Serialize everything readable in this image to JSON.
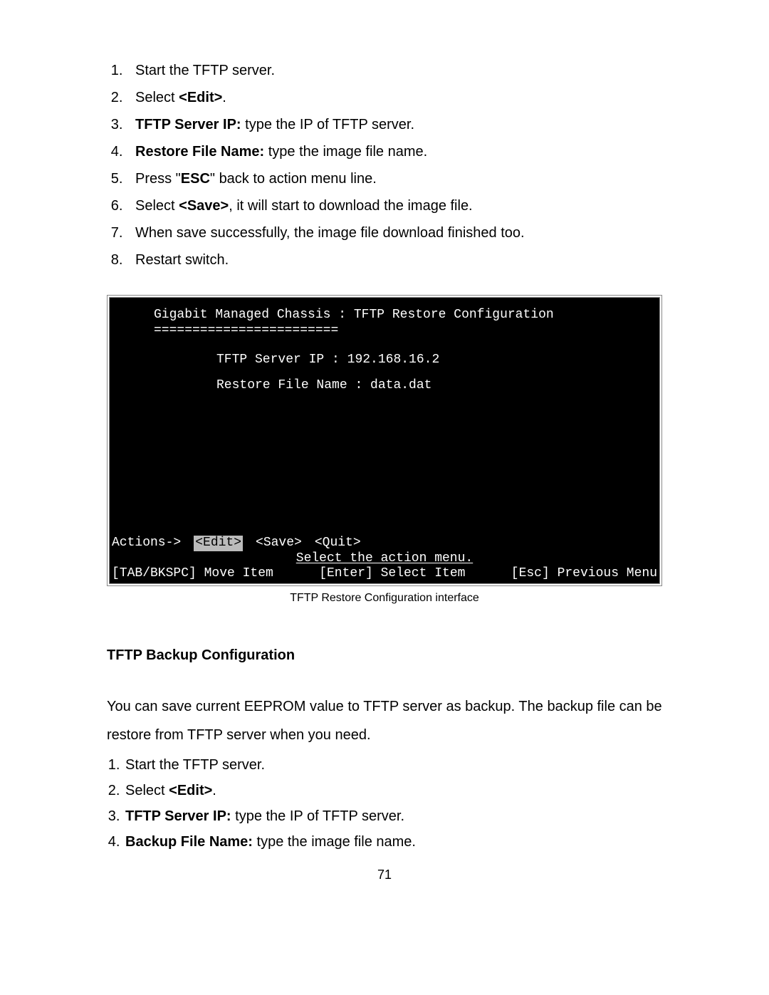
{
  "steps_top": [
    {
      "pre": "Start the TFTP server.",
      "bold": "",
      "post": ""
    },
    {
      "pre": "Select ",
      "bold": "<Edit>",
      "post": "."
    },
    {
      "pre": "",
      "bold": "TFTP Server IP:",
      "post": " type the IP of TFTP server."
    },
    {
      "pre": "",
      "bold": "Restore File Name:",
      "post": " type the image file name."
    },
    {
      "pre": "Press \"",
      "bold": "ESC",
      "post": "\" back to action menu line."
    },
    {
      "pre": "Select ",
      "bold": "<Save>",
      "post": ", it will start to download the image file."
    },
    {
      "pre": "When save successfully, the image file download finished too.",
      "bold": "",
      "post": ""
    },
    {
      "pre": "Restart switch.",
      "bold": "",
      "post": ""
    }
  ],
  "terminal": {
    "title": "Gigabit Managed Chassis : TFTP Restore Configuration",
    "rule": "========================",
    "ip_label": "TFTP Server IP",
    "ip_sep": "   : ",
    "ip_value": "192.168.16.2",
    "file_label": "Restore File Name",
    "file_sep": " : ",
    "file_value": "data.dat",
    "actions_label": "Actions->",
    "edit": "<Edit>",
    "save": "<Save>",
    "quit": "<Quit>",
    "hint": "Select the action menu.",
    "foot_left": "[TAB/BKSPC] Move Item",
    "foot_mid": "[Enter] Select Item",
    "foot_right": "[Esc] Previous Menu"
  },
  "caption": "TFTP Restore Configuration interface",
  "section_title": "TFTP Backup Configuration",
  "para": "You can save current EEPROM value to TFTP server as backup. The backup file can be restore from TFTP server when you need.",
  "steps_bottom": [
    {
      "pre": "Start the TFTP server.",
      "bold": "",
      "post": ""
    },
    {
      "pre": "Select ",
      "bold": "<Edit>",
      "post": "."
    },
    {
      "pre": "",
      "bold": "TFTP Server IP:",
      "post": " type the IP of TFTP server."
    },
    {
      "pre": "",
      "bold": "Backup File Name:",
      "post": " type the image file name."
    }
  ],
  "page_num": "71"
}
